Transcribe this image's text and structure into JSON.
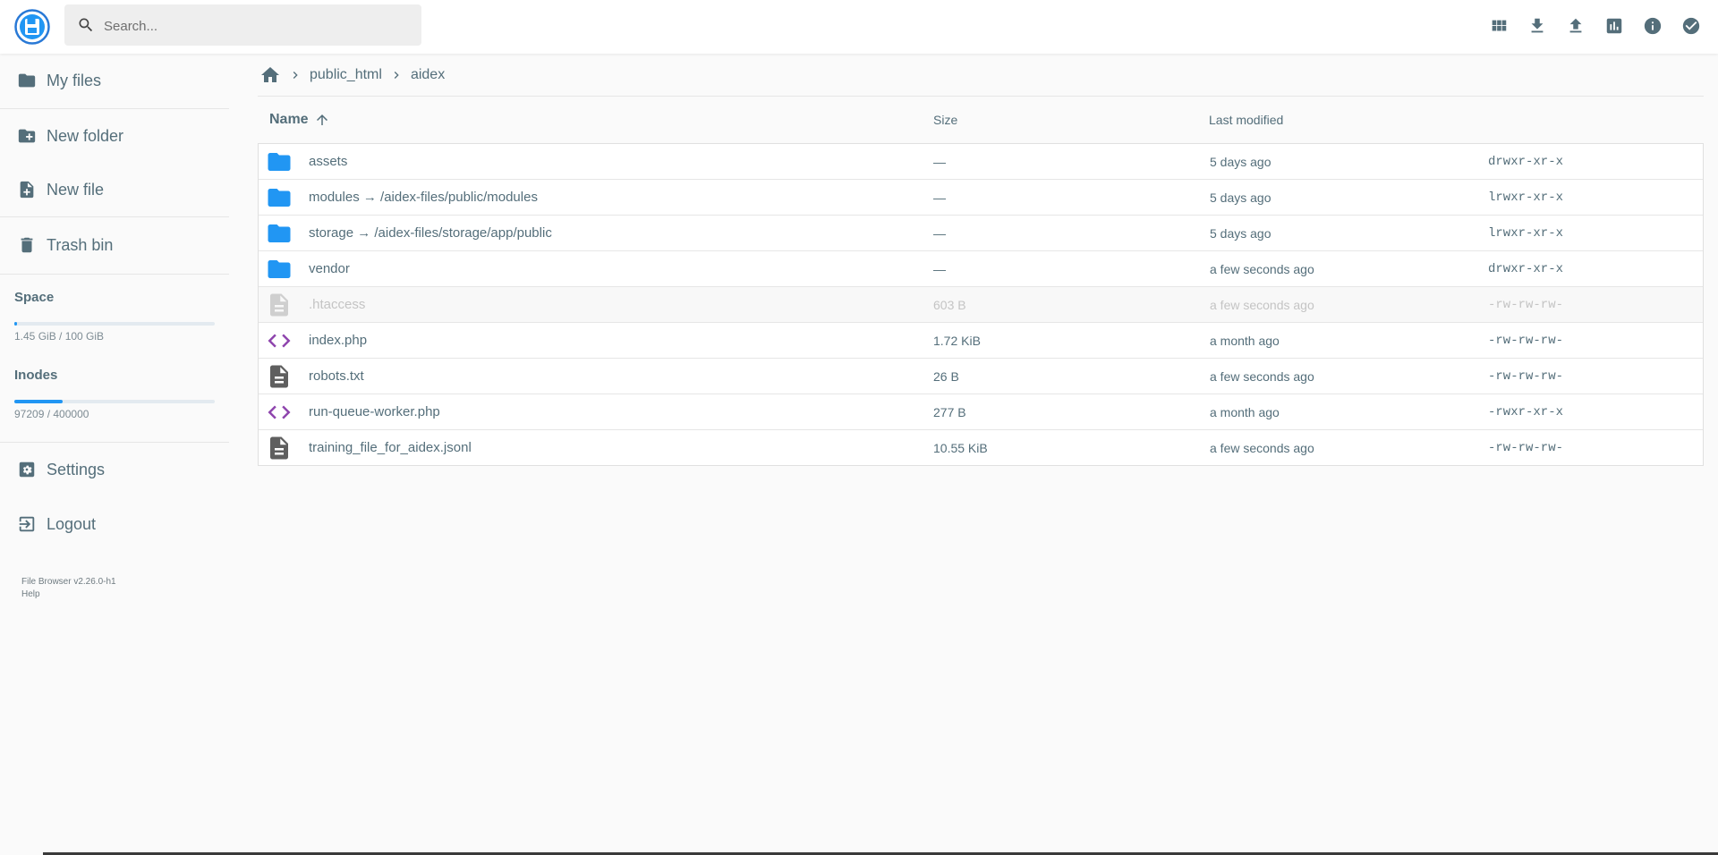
{
  "search": {
    "placeholder": "Search..."
  },
  "header": {
    "actions": [
      {
        "icon": "grid-view-icon"
      },
      {
        "icon": "download-icon"
      },
      {
        "icon": "upload-icon"
      },
      {
        "icon": "bar-chart-icon"
      },
      {
        "icon": "info-icon"
      },
      {
        "icon": "check-circle-icon"
      }
    ]
  },
  "sidebar": {
    "items": [
      {
        "label": "My files",
        "icon": "folder-icon"
      },
      {
        "label": "New folder",
        "icon": "create-new-folder-icon"
      },
      {
        "label": "New file",
        "icon": "note-add-icon"
      },
      {
        "label": "Trash bin",
        "icon": "trash-icon"
      }
    ],
    "space": {
      "title": "Space",
      "text": "1.45 GiB / 100 GiB",
      "fraction": 0.0145
    },
    "inodes": {
      "title": "Inodes",
      "text": "97209 / 400000",
      "fraction": 0.243
    },
    "settings": "Settings",
    "logout": "Logout",
    "version": "File Browser v2.26.0-h1",
    "help": "Help"
  },
  "breadcrumb": {
    "items": [
      "public_html",
      "aidex"
    ]
  },
  "table": {
    "headers": {
      "name": "Name",
      "size": "Size",
      "modified": "Last modified"
    },
    "rows": [
      {
        "type": "folder",
        "name": "assets",
        "size": "—",
        "modified": "5 days ago",
        "perm": "drwxr-xr-x"
      },
      {
        "type": "folder",
        "name": "modules → /aidex-files/public/modules",
        "size": "—",
        "modified": "5 days ago",
        "perm": "lrwxr-xr-x"
      },
      {
        "type": "folder",
        "name": "storage → /aidex-files/storage/app/public",
        "size": "—",
        "modified": "5 days ago",
        "perm": "lrwxr-xr-x"
      },
      {
        "type": "folder",
        "name": "vendor",
        "size": "—",
        "modified": "a few seconds ago",
        "perm": "drwxr-xr-x"
      },
      {
        "type": "file-hidden",
        "name": ".htaccess",
        "size": "603 B",
        "modified": "a few seconds ago",
        "perm": "-rw-rw-rw-"
      },
      {
        "type": "code",
        "name": "index.php",
        "size": "1.72 KiB",
        "modified": "a month ago",
        "perm": "-rw-rw-rw-"
      },
      {
        "type": "file",
        "name": "robots.txt",
        "size": "26 B",
        "modified": "a few seconds ago",
        "perm": "-rw-rw-rw-"
      },
      {
        "type": "code",
        "name": "run-queue-worker.php",
        "size": "277 B",
        "modified": "a month ago",
        "perm": "-rwxr-xr-x"
      },
      {
        "type": "file",
        "name": "training_file_for_aidex.jsonl",
        "size": "10.55 KiB",
        "modified": "a few seconds ago",
        "perm": "-rw-rw-rw-"
      }
    ]
  },
  "colors": {
    "accent": "#2196f3",
    "text": "#546e7a",
    "code_icon": "#8e44ad",
    "hidden_text": "#c4c4c4"
  }
}
